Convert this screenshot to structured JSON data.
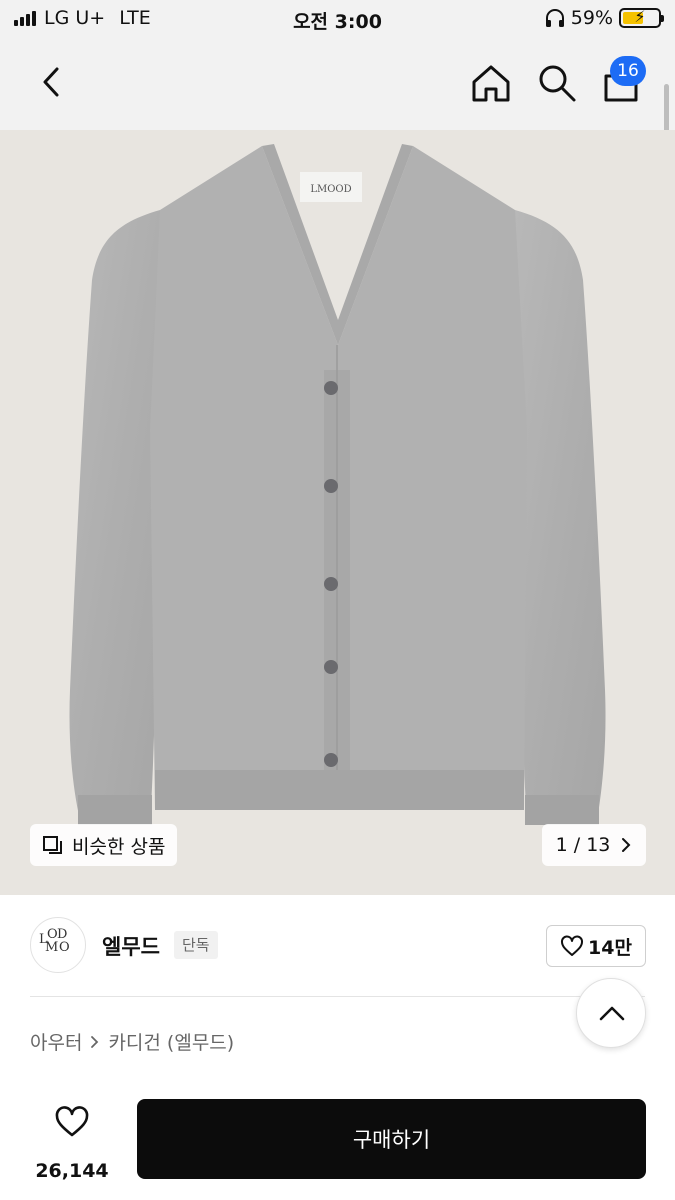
{
  "status_bar": {
    "carrier": "LG U+",
    "network": "LTE",
    "time": "오전 3:00",
    "battery_percent": "59%",
    "battery_level": 0.59
  },
  "nav": {
    "icons": [
      "chevron-left-icon",
      "home-icon",
      "search-icon",
      "cart-icon"
    ],
    "cart_count": "16"
  },
  "gallery": {
    "similar_label": "비슷한 상품",
    "page_counter": "1 / 13",
    "current_page": 1,
    "total_pages": 13
  },
  "brand": {
    "logo_text": "LMOOD",
    "name": "엘무드",
    "tag": "단독",
    "likes": "14만"
  },
  "breadcrumb": {
    "items": [
      "아우터",
      "카디건 (엘무드)"
    ]
  },
  "bottom": {
    "wish_count": "26,144",
    "buy_label": "구매하기"
  },
  "colors": {
    "badge": "#1d6cf5",
    "buy_button": "#0c0c0c",
    "background_gray": "#f2f2f2"
  }
}
